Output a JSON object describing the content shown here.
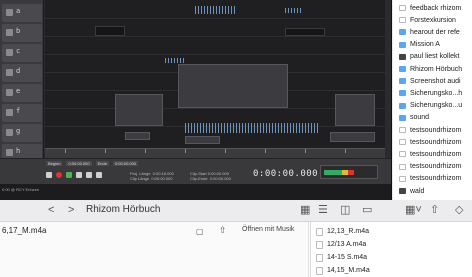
{
  "daw": {
    "tracks": [
      "a",
      "b",
      "c",
      "d",
      "e",
      "f",
      "g",
      "h",
      "i"
    ],
    "transport": {
      "labels": [
        "Beginn",
        "0:00:00.000",
        "Ende",
        "0:00:00.000"
      ],
      "info": "Proj. Länge  0:00:18.000\nClip Länge  0:00:00.000",
      "clip_info": "Clip-Start 0:00:00.000\nClip-Ende  0:00:00.000",
      "timecode": "0:00:00.000"
    },
    "footer_text": "0:00 @ RCY Enhzen"
  },
  "file_list": {
    "items": [
      {
        "icon": "doc-icon",
        "label": "feedback rhizom"
      },
      {
        "icon": "doc-icon",
        "label": "Forstexkursion"
      },
      {
        "icon": "folder-icon",
        "label": "hearout der refe"
      },
      {
        "icon": "folder-icon",
        "label": "Mission A"
      },
      {
        "icon": "dark-icon",
        "label": "paul liest kollekt"
      },
      {
        "icon": "folder-icon",
        "label": "Rhizom Hörbuch"
      },
      {
        "icon": "folder-icon",
        "label": "Screenshot audi"
      },
      {
        "icon": "folder-icon",
        "label": "Sicherungsko...h"
      },
      {
        "icon": "folder-icon",
        "label": "Sicherungsko...u"
      },
      {
        "icon": "folder-icon",
        "label": "sound"
      },
      {
        "icon": "doc-icon",
        "label": "testsoundrhizom"
      },
      {
        "icon": "doc-icon",
        "label": "testsoundrhizom"
      },
      {
        "icon": "doc-icon",
        "label": "testsoundrhizom"
      },
      {
        "icon": "doc-icon",
        "label": "testsoundrhizom"
      },
      {
        "icon": "doc-icon",
        "label": "testsoundrhizom"
      },
      {
        "icon": "dark-icon",
        "label": "wald"
      }
    ]
  },
  "finder": {
    "title": "Rhizom Hörbuch",
    "nav_back": "<",
    "nav_forward": ">",
    "preview_file": "6,17_M.m4a",
    "open_with": "Öffnen mit Musik",
    "column_items": [
      "12,13_R.m4a",
      "12/13 A.m4a",
      "14-15 S.m4a",
      "14,15_M.m4a"
    ]
  },
  "colors": {
    "daw_bg": "#2b2b2d",
    "folder": "#59a7f0",
    "record": "#dd3333",
    "play": "#4fb34f"
  }
}
